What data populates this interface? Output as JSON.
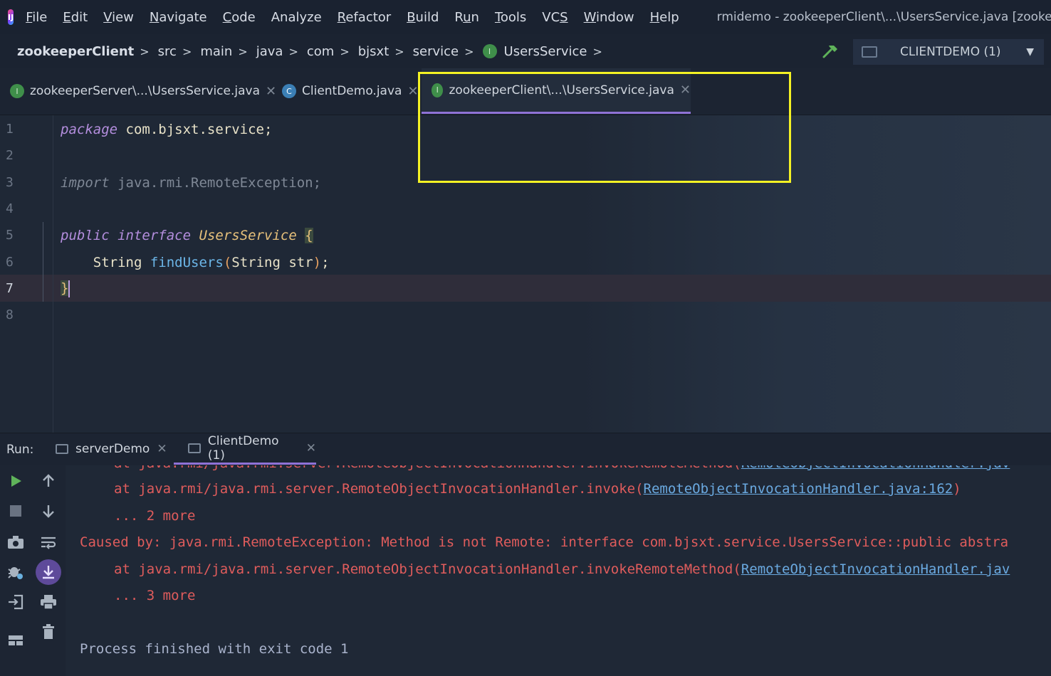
{
  "menubar": {
    "items": [
      "File",
      "Edit",
      "View",
      "Navigate",
      "Code",
      "Analyze",
      "Refactor",
      "Build",
      "Run",
      "Tools",
      "VCS",
      "Window",
      "Help"
    ],
    "mnemonics": [
      "F",
      "E",
      "V",
      "N",
      "C",
      "",
      "R",
      "B",
      "u",
      "T",
      "S",
      "W",
      "H"
    ],
    "window_title": "rmidemo - zookeeperClient\\...\\UsersService.java [zookeeperClie"
  },
  "navbar": {
    "crumbs": [
      "zookeeperClient",
      "src",
      "main",
      "java",
      "com",
      "bjsxt",
      "service",
      "UsersService"
    ],
    "run_config": "CLIENTDEMO (1)"
  },
  "tabs": [
    {
      "label": "zookeeperServer\\...\\UsersService.java",
      "icon": "interface-icon"
    },
    {
      "label": "ClientDemo.java",
      "icon": "class-icon"
    },
    {
      "label": "zookeeperClient\\...\\UsersService.java",
      "icon": "interface-icon",
      "active": true
    }
  ],
  "editor": {
    "line_numbers": [
      "1",
      "2",
      "3",
      "4",
      "5",
      "6",
      "7",
      "8"
    ],
    "active_line": "7",
    "lines": {
      "l1_kw": "package",
      "l1_rest": " com.bjsxt.service;",
      "l3_kw": "import",
      "l3_rest": " java.rmi.RemoteException;",
      "l5_kw1": "public",
      "l5_kw2": "interface",
      "l5_name": "UsersService",
      "l5_brace": "{",
      "l6_type": "String",
      "l6_method": "findUsers",
      "l6_open": "(",
      "l6_params": "String str",
      "l6_close": ")",
      "l6_semi": ";",
      "l7_brace": "}"
    }
  },
  "run": {
    "label": "Run:",
    "tabs": [
      "serverDemo",
      "ClientDemo (1)"
    ],
    "console": {
      "l0_text": "at java.rmi/java.rmi.server.RemoteObjectInvocationHandler.invokeRemoteMethod(",
      "l0_link": "RemoteObjectInvocationHandler.jav",
      "l1_text": "at java.rmi/java.rmi.server.RemoteObjectInvocationHandler.invoke(",
      "l1_link": "RemoteObjectInvocationHandler.java:162",
      "l1_end": ")",
      "l2": "... 2 more",
      "l3": "Caused by: java.rmi.RemoteException: Method is not Remote: interface com.bjsxt.service.UsersService::public abstra",
      "l4_text": "at java.rmi/java.rmi.server.RemoteObjectInvocationHandler.invokeRemoteMethod(",
      "l4_link": "RemoteObjectInvocationHandler.jav",
      "l5": "... 3 more",
      "l6": "Process finished with exit code 1"
    }
  },
  "icons": {
    "interface_letter": "I",
    "class_letter": "C"
  },
  "colors": {
    "highlight_box": "#f4f224",
    "active_tab_underline": "#8f72d6",
    "error_text": "#e05c5c",
    "link": "#6aa9e0"
  }
}
